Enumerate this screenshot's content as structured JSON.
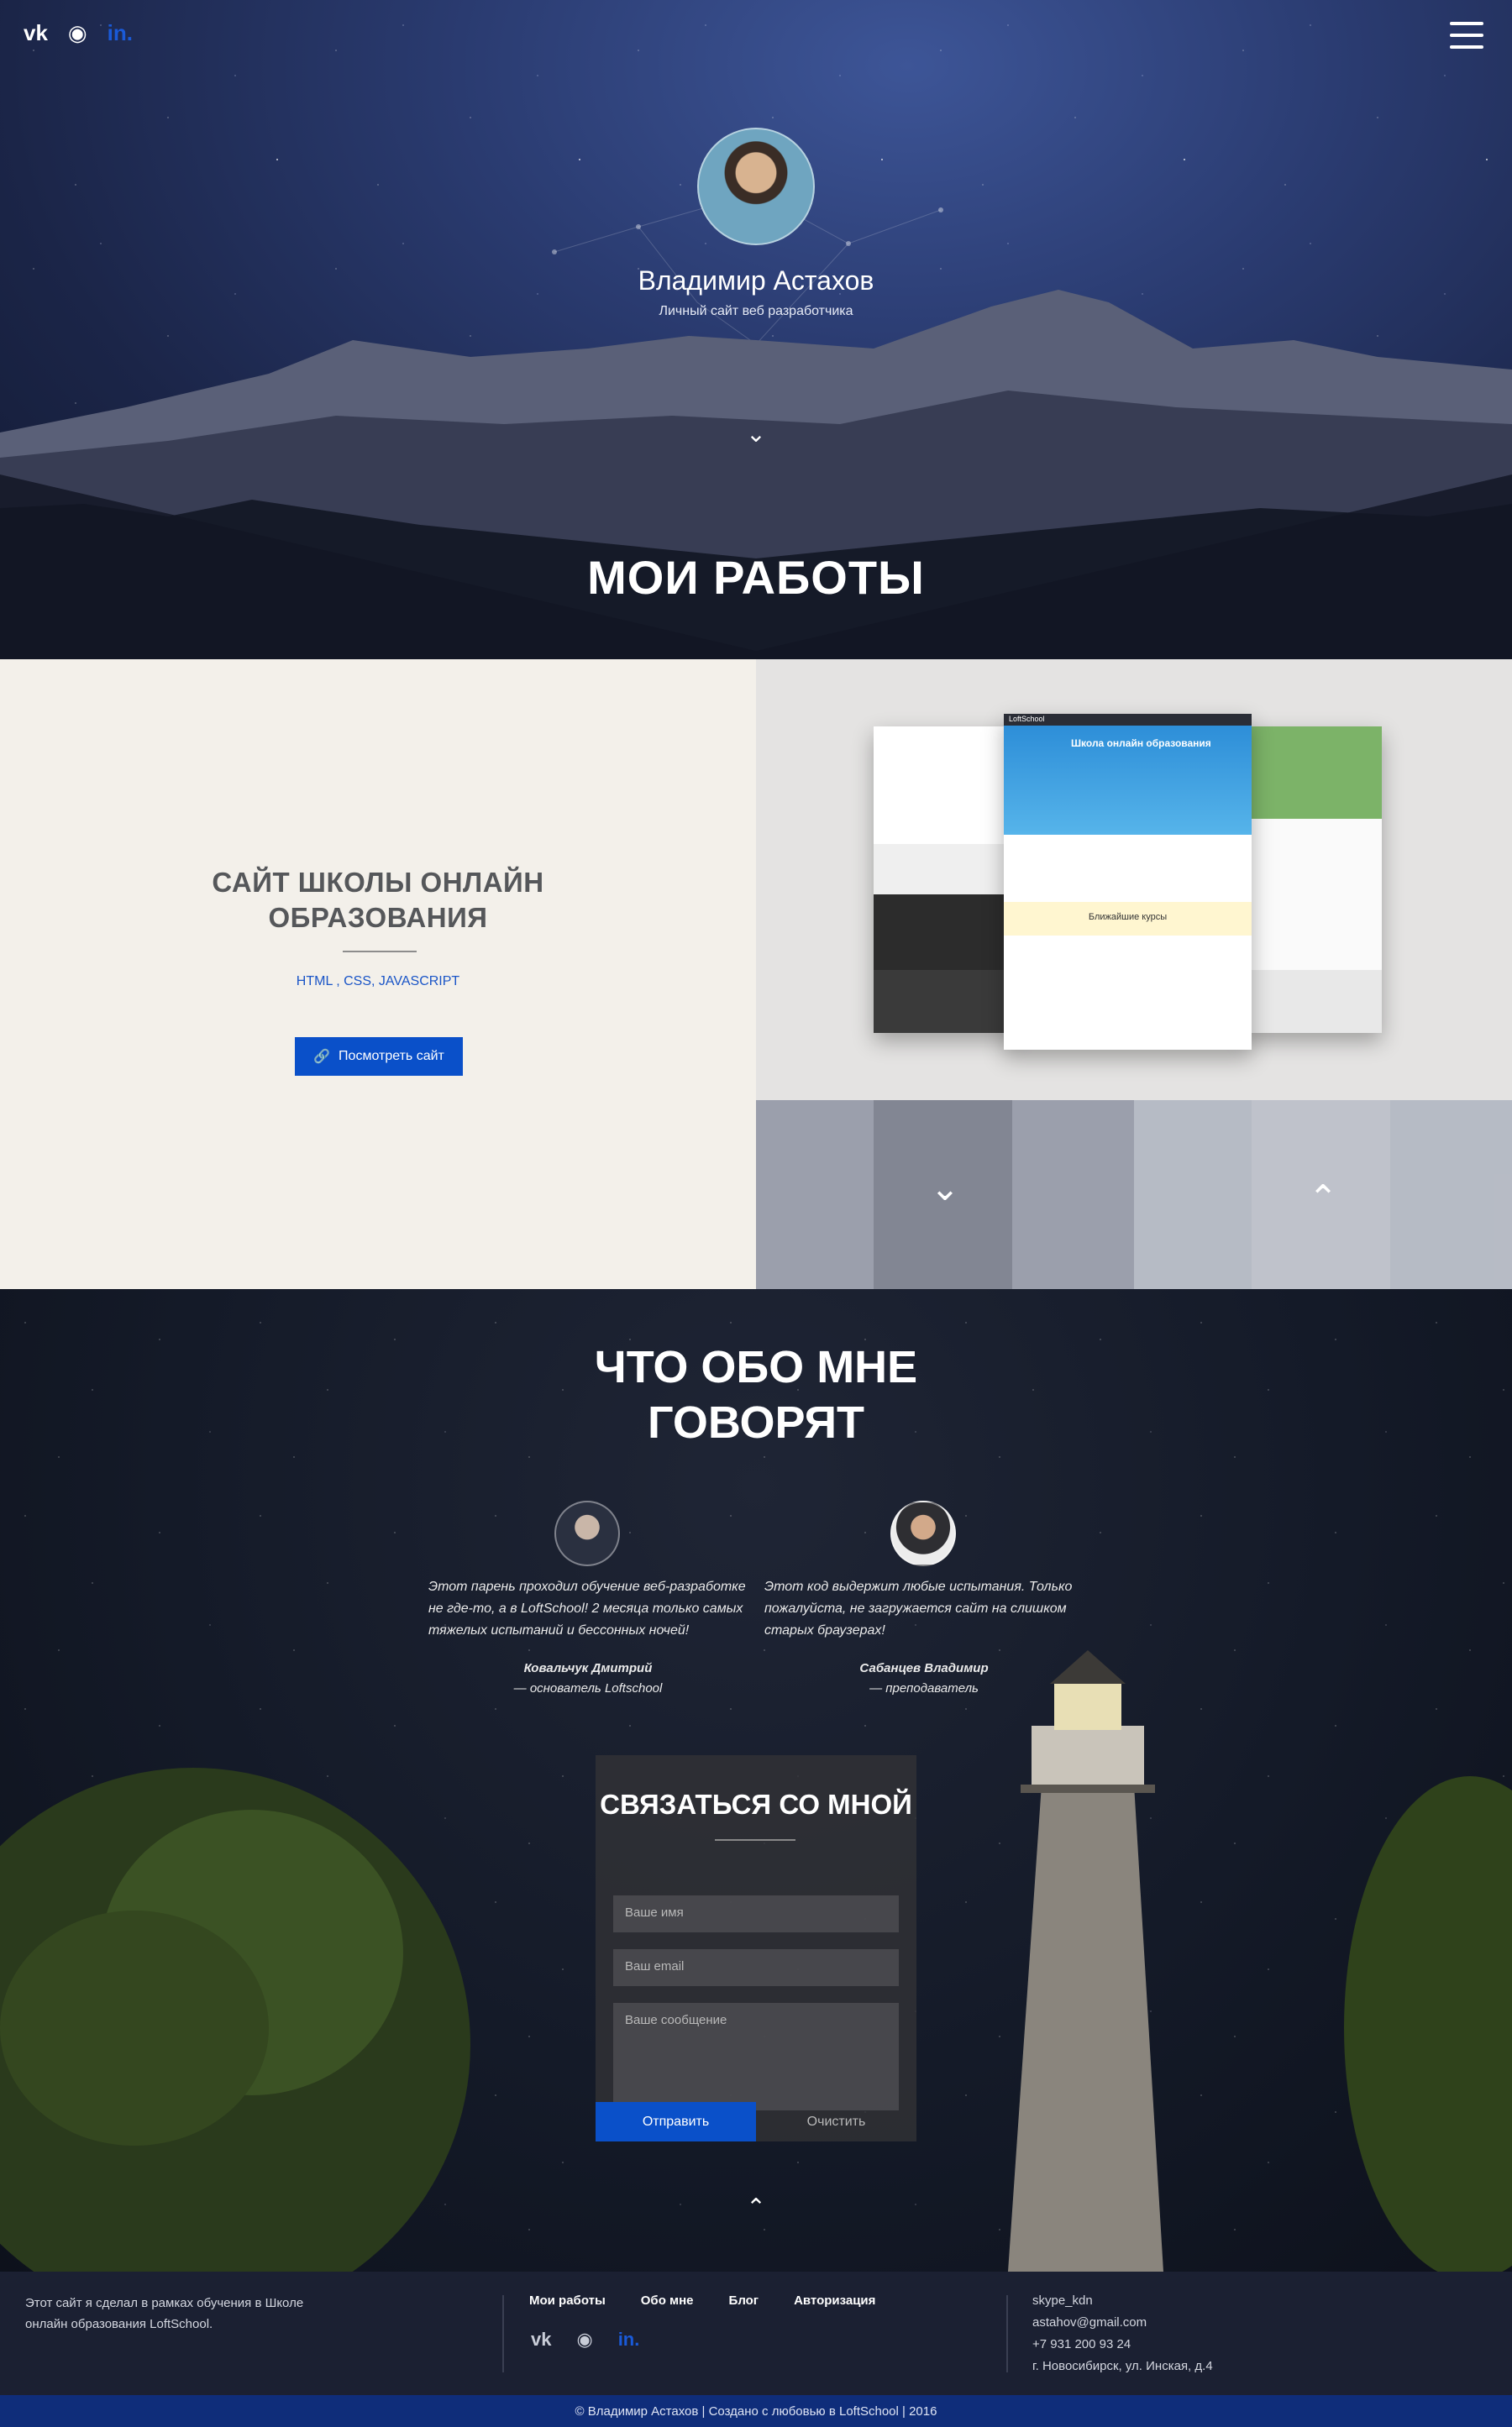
{
  "header": {
    "social": [
      {
        "icon": "vk-icon",
        "label": "VK"
      },
      {
        "icon": "github-icon",
        "label": "GitHub"
      },
      {
        "icon": "linkedin-icon",
        "label": "in."
      }
    ],
    "menu_icon": "hamburger-icon"
  },
  "hero": {
    "name": "Владимир Астахов",
    "subtitle": "Личный сайт веб разработчика",
    "section_title": "МОИ РАБОТЫ"
  },
  "works": {
    "title_line1": "САЙТ ШКОЛЫ ОНЛАЙН",
    "title_line2": "ОБРАЗОВАНИЯ",
    "tech": "HTML , CSS, JAVASCRIPT",
    "button_label": "Посмотреть сайт",
    "mock": {
      "brand": "LoftSchool",
      "heading": "Школа онлайн образования",
      "courses": "Ближайшие курсы"
    }
  },
  "testimonials": {
    "title_line1": "ЧТО ОБО МНЕ",
    "title_line2": "ГОВОРЯТ",
    "items": [
      {
        "text": "Этот парень проходил обучение веб-разработке не где-то, а в LoftSchool! 2 месяца только самых тяжелых испытаний и бессонных ночей!",
        "author": "Ковальчук Дмитрий",
        "role": "— основатель Loftschool"
      },
      {
        "text": "Этот код выдержит любые испытания. Только пожалуйста, не загружается сайт на слишком старых браузерах!",
        "author": "Сабанцев Владимир",
        "role": "— преподаватель"
      }
    ]
  },
  "contact": {
    "title": "СВЯЗАТЬСЯ СО МНОЙ",
    "name_placeholder": "Ваше имя",
    "email_placeholder": "Ваш email",
    "message_placeholder": "Ваше сообщение",
    "send_label": "Отправить",
    "clear_label": "Очистить"
  },
  "footer": {
    "about": "Этот сайт я сделал в рамках обучения в Школе онлайн образования LoftSchool.",
    "nav": [
      "Мои работы",
      "Обо мне",
      "Блог",
      "Авторизация"
    ],
    "contacts": [
      "skype_kdn",
      "astahov@gmail.com",
      "+7 931 200 93 24",
      "г. Новосибирск, ул. Инская, д.4"
    ],
    "copyright": "© Владимир Астахов | Создано с любовью в LoftSchool | 2016"
  },
  "colors": {
    "accent": "#0a50c9",
    "hero_bg": "#1b2548",
    "works_left_bg": "#f3f0ea",
    "footer_bg": "#1b2032",
    "copyright_bg": "#0f2d7a"
  }
}
